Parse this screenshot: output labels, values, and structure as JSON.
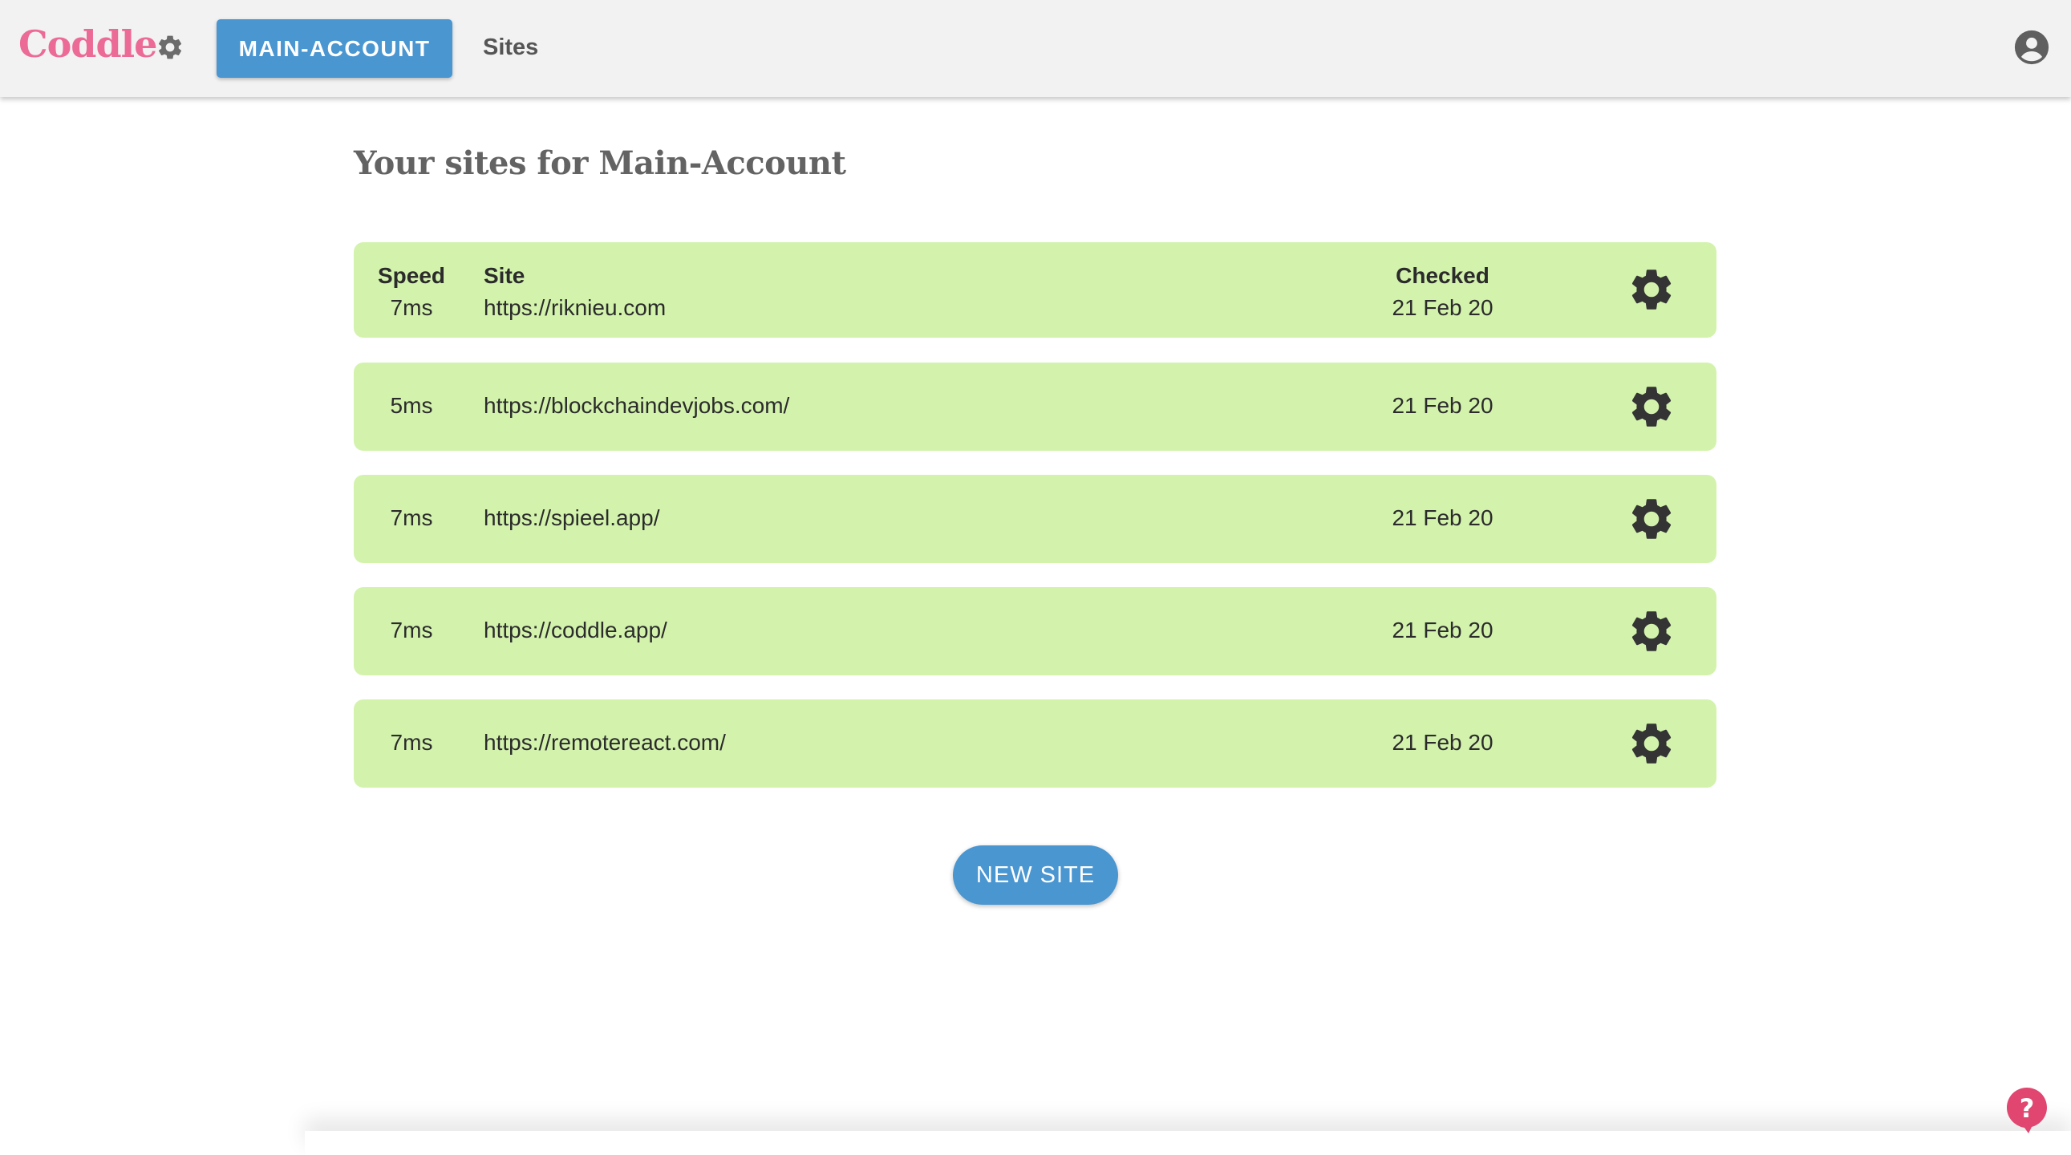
{
  "app": {
    "brand": "Coddle"
  },
  "header": {
    "account_label": "MAIN-ACCOUNT",
    "nav_sites": "Sites"
  },
  "main": {
    "title": "Your sites for Main-Account",
    "columns": {
      "speed": "Speed",
      "site": "Site",
      "checked": "Checked"
    },
    "sites": [
      {
        "speed": "7ms",
        "url": "https://riknieu.com",
        "checked": "21 Feb 20"
      },
      {
        "speed": "5ms",
        "url": "https://blockchaindevjobs.com/",
        "checked": "21 Feb 20"
      },
      {
        "speed": "7ms",
        "url": "https://spieel.app/",
        "checked": "21 Feb 20"
      },
      {
        "speed": "7ms",
        "url": "https://coddle.app/",
        "checked": "21 Feb 20"
      },
      {
        "speed": "7ms",
        "url": "https://remotereact.com/",
        "checked": "21 Feb 20"
      }
    ],
    "new_site_label": "NEW SITE"
  },
  "icons": {
    "brand": "gear-icon",
    "user": "account-circle-icon",
    "row": "gear-icon",
    "help": "help-bubble-icon"
  },
  "colors": {
    "brand": "#ec6a96",
    "primary": "#4a96d1",
    "row_background": "#d3f3ad",
    "help": "#e0466f"
  }
}
